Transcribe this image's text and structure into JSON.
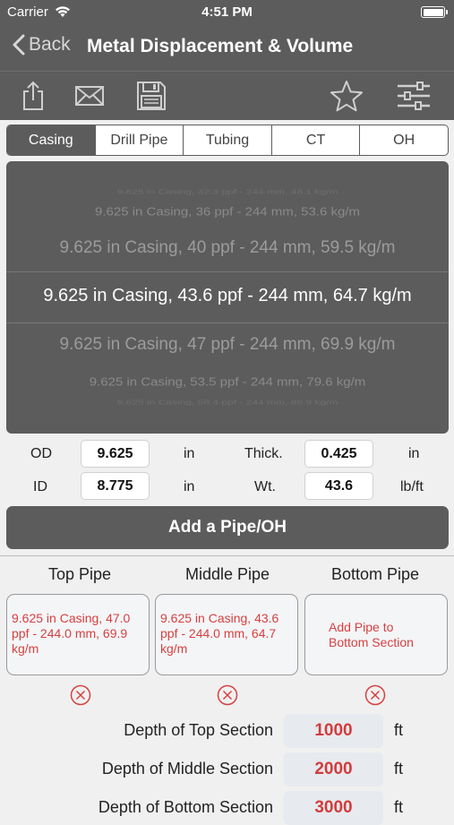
{
  "status": {
    "carrier": "Carrier",
    "time": "4:51 PM"
  },
  "nav": {
    "back_label": "Back",
    "title": "Metal Displacement & Volume"
  },
  "toolbar": {
    "icons": [
      "share-icon",
      "mail-icon",
      "save-icon",
      "favorite-star-icon",
      "settings-sliders-icon"
    ]
  },
  "segments": {
    "items": [
      "Casing",
      "Drill Pipe",
      "Tubing",
      "CT",
      "OH"
    ],
    "selected": "Casing"
  },
  "picker": {
    "rows": [
      "9.625 in Casing, 32.3 ppf - 244 mm, 48.1 kg/m",
      "9.625 in Casing, 36 ppf - 244 mm, 53.6 kg/m",
      "9.625 in Casing, 40 ppf - 244 mm, 59.5 kg/m",
      "9.625 in Casing, 43.6 ppf - 244 mm, 64.7 kg/m",
      "9.625 in Casing, 47 ppf - 244 mm, 69.9 kg/m",
      "9.625 in Casing, 53.5 ppf - 244 mm, 79.6 kg/m",
      "9.625 in Casing, 58.4 ppf - 244 mm, 86.9 kg/m"
    ],
    "selected": "9.625 in Casing, 43.6 ppf - 244 mm, 64.7 kg/m"
  },
  "props": {
    "od_label": "OD",
    "od_value": "9.625",
    "od_unit": "in",
    "id_label": "ID",
    "id_value": "8.775",
    "id_unit": "in",
    "thick_label": "Thick.",
    "thick_value": "0.425",
    "thick_unit": "in",
    "wt_label": "Wt.",
    "wt_value": "43.6",
    "wt_unit": "lb/ft"
  },
  "add_button": {
    "label": "Add a Pipe/OH"
  },
  "columns": {
    "top_label": "Top Pipe",
    "middle_label": "Middle Pipe",
    "bottom_label": "Bottom Pipe",
    "top_value": "9.625 in Casing, 47.0 ppf - 244.0 mm, 69.9 kg/m",
    "middle_value": "9.625 in Casing, 43.6 ppf - 244.0 mm, 64.7 kg/m",
    "bottom_value": "Add Pipe to Bottom Section"
  },
  "depths": [
    {
      "label": "Depth of Top Section",
      "value": "1000",
      "unit": "ft"
    },
    {
      "label": "Depth of Middle Section",
      "value": "2000",
      "unit": "ft"
    },
    {
      "label": "Depth of Bottom Section",
      "value": "3000",
      "unit": "ft"
    }
  ],
  "colors": {
    "bar": "#5c5c5c",
    "accent_red": "#d64040",
    "background": "#f0f0f0"
  }
}
